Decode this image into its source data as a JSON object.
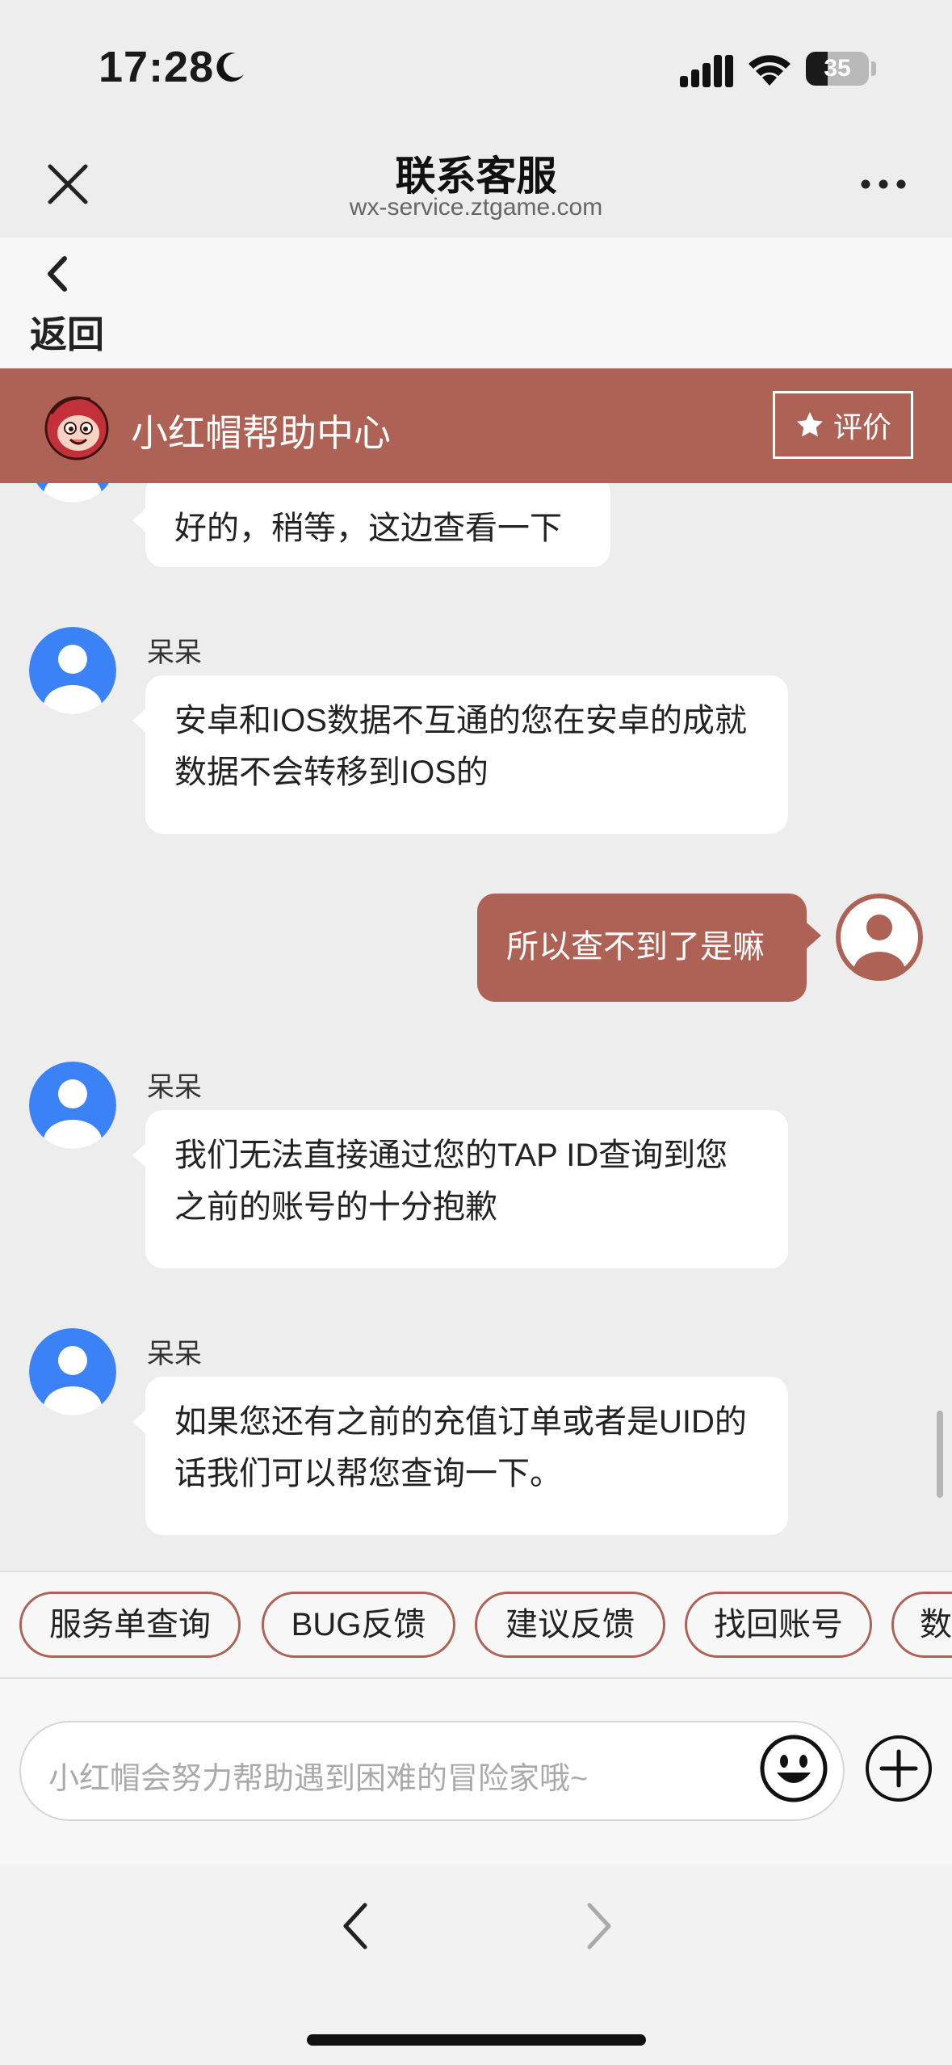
{
  "status_bar": {
    "time": "17:28",
    "battery_level": "35",
    "battery_fraction": 0.35
  },
  "nav": {
    "title": "联系客服",
    "subtitle": "wx-service.ztgame.com"
  },
  "back": {
    "label": "返回"
  },
  "help_header": {
    "title": "小红帽帮助中心",
    "rate_label": "评价"
  },
  "messages": [
    {
      "side": "left",
      "sender": "",
      "text": "好的，稍等，这边查看一下"
    },
    {
      "side": "left",
      "sender": "呆呆",
      "text": "安卓和IOS数据不互通的您在安卓的成就数据不会转移到IOS的"
    },
    {
      "side": "right",
      "sender": "",
      "text": "所以查不到了是嘛"
    },
    {
      "side": "left",
      "sender": "呆呆",
      "text": "我们无法直接通过您的TAP ID查询到您之前的账号的十分抱歉"
    },
    {
      "side": "left",
      "sender": "呆呆",
      "text": "如果您还有之前的充值订单或者是UID的话我们可以帮您查询一下。"
    }
  ],
  "quick_chips": [
    "服务单查询",
    "BUG反馈",
    "建议反馈",
    "找回账号",
    "数"
  ],
  "input": {
    "placeholder": "小红帽会努力帮助遇到困难的冒险家哦~"
  },
  "icons": {
    "close": "close-icon",
    "more": "more-icon",
    "back": "chevron-left-icon",
    "star": "star-icon",
    "emoji": "emoji-icon",
    "plus": "plus-icon",
    "browser_back": "browser-back-icon",
    "browser_forward": "browser-forward-icon"
  },
  "colors": {
    "brand": "#ad6255",
    "avatar_agent": "#3b82f6",
    "avatar_user": "#ad6255"
  }
}
